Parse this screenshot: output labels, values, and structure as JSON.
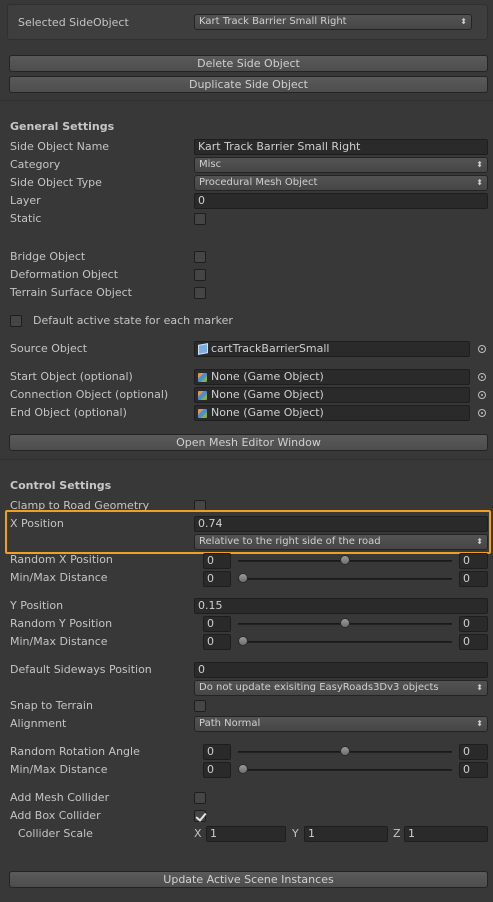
{
  "top": {
    "selected_label": "Selected SideObject",
    "selected_value": "Kart Track Barrier Small Right"
  },
  "buttons": {
    "delete": "Delete Side Object",
    "duplicate": "Duplicate Side Object",
    "open_mesh_editor": "Open Mesh Editor Window",
    "update_instances": "Update Active Scene Instances"
  },
  "general": {
    "header": "General Settings",
    "name_label": "Side Object Name",
    "name_value": "Kart Track Barrier Small Right",
    "category_label": "Category",
    "category_value": "Misc",
    "type_label": "Side Object Type",
    "type_value": "Procedural Mesh Object",
    "layer_label": "Layer",
    "layer_value": "0",
    "static_label": "Static",
    "static_checked": false,
    "bridge_label": "Bridge Object",
    "bridge_checked": false,
    "deformation_label": "Deformation Object",
    "deformation_checked": false,
    "terrain_surface_label": "Terrain Surface Object",
    "terrain_surface_checked": false,
    "default_active_label": "Default active state for each marker",
    "default_active_checked": false,
    "source_label": "Source Object",
    "source_value": "cartTrackBarrierSmall",
    "start_label": "Start Object (optional)",
    "start_value": "None (Game Object)",
    "connection_label": "Connection Object (optional)",
    "connection_value": "None (Game Object)",
    "end_label": "End Object (optional)",
    "end_value": "None (Game Object)"
  },
  "control": {
    "header": "Control Settings",
    "clamp_label": "Clamp to Road Geometry",
    "clamp_checked": false,
    "xpos_label": "X Position",
    "xpos_value": "0.74",
    "xpos_mode": "Relative to the right side of the road",
    "random_x_label": "Random X Position",
    "random_x_min": "0",
    "random_x_max": "0",
    "random_x_level": 0.5,
    "minmax_label": "Min/Max Distance",
    "minmax1_min": "0",
    "minmax1_max": "0",
    "minmax1_level": 0.0,
    "ypos_label": "Y Position",
    "ypos_value": "0.15",
    "random_y_label": "Random Y Position",
    "random_y_min": "0",
    "random_y_max": "0",
    "random_y_level": 0.5,
    "minmax2_min": "0",
    "minmax2_max": "0",
    "minmax2_level": 0.0,
    "sideways_label": "Default Sideways Position",
    "sideways_value": "0",
    "sideways_mode": "Do not update exisiting EasyRoads3Dv3 objects",
    "snap_label": "Snap to Terrain",
    "snap_checked": false,
    "alignment_label": "Alignment",
    "alignment_value": "Path Normal",
    "random_rot_label": "Random Rotation Angle",
    "random_rot_min": "0",
    "random_rot_max": "0",
    "random_rot_level": 0.5,
    "minmax3_min": "0",
    "minmax3_max": "0",
    "minmax3_level": 0.0,
    "mesh_collider_label": "Add Mesh Collider",
    "mesh_collider_checked": false,
    "box_collider_label": "Add Box Collider",
    "box_collider_checked": true,
    "collider_scale_label": "Collider Scale",
    "axis_x": "X",
    "axis_y": "Y",
    "axis_z": "Z",
    "scale_x": "1",
    "scale_y": "1",
    "scale_z": "1"
  },
  "icons": {
    "dropdown_arrow": "⬍"
  }
}
